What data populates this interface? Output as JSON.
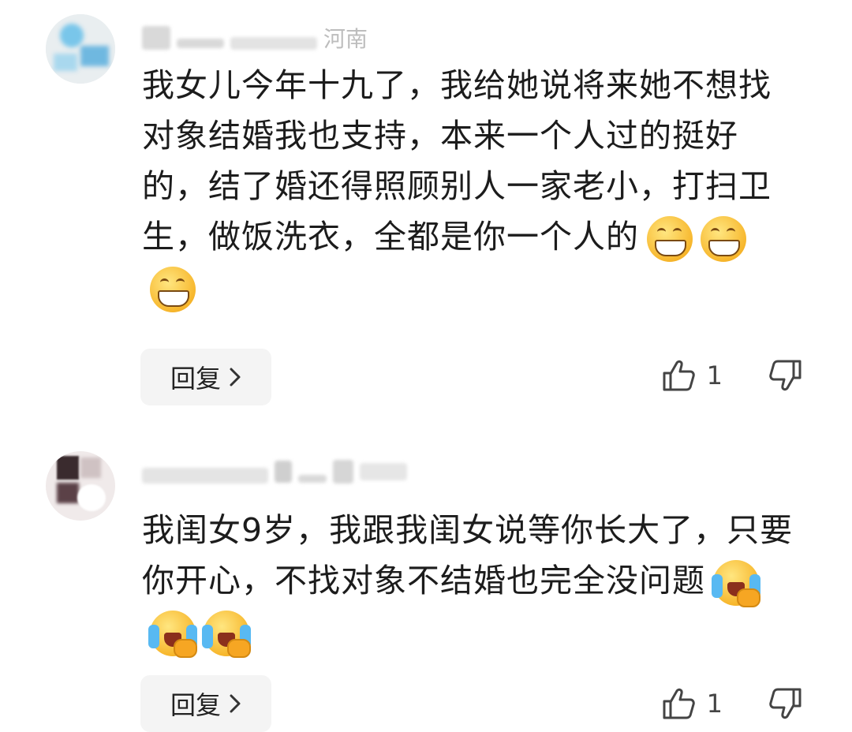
{
  "comments": [
    {
      "username_suffix": "河南",
      "text": "我女儿今年十九了，我给她说将来她不想找对象结婚我也支持，本来一个人过的挺好的，结了婚还得照顾别人一家老小，打扫卫生，做饭洗衣，全都是你一个人的",
      "emoji_count": 3,
      "reply_label": "回复",
      "likes": "1"
    },
    {
      "username_suffix": "",
      "text": "我闺女9岁，我跟我闺女说等你长大了，只要你开心，不找对象不结婚也完全没问题",
      "emoji_count": 3,
      "reply_label": "回复",
      "likes": "1"
    }
  ],
  "icons": {
    "like": "thumbs-up-icon",
    "dislike": "thumbs-down-icon",
    "reply_chevron": "chevron-right-icon",
    "emoji_1": "grinning-face-emoji",
    "emoji_2": "laughing-crying-face-emoji"
  }
}
